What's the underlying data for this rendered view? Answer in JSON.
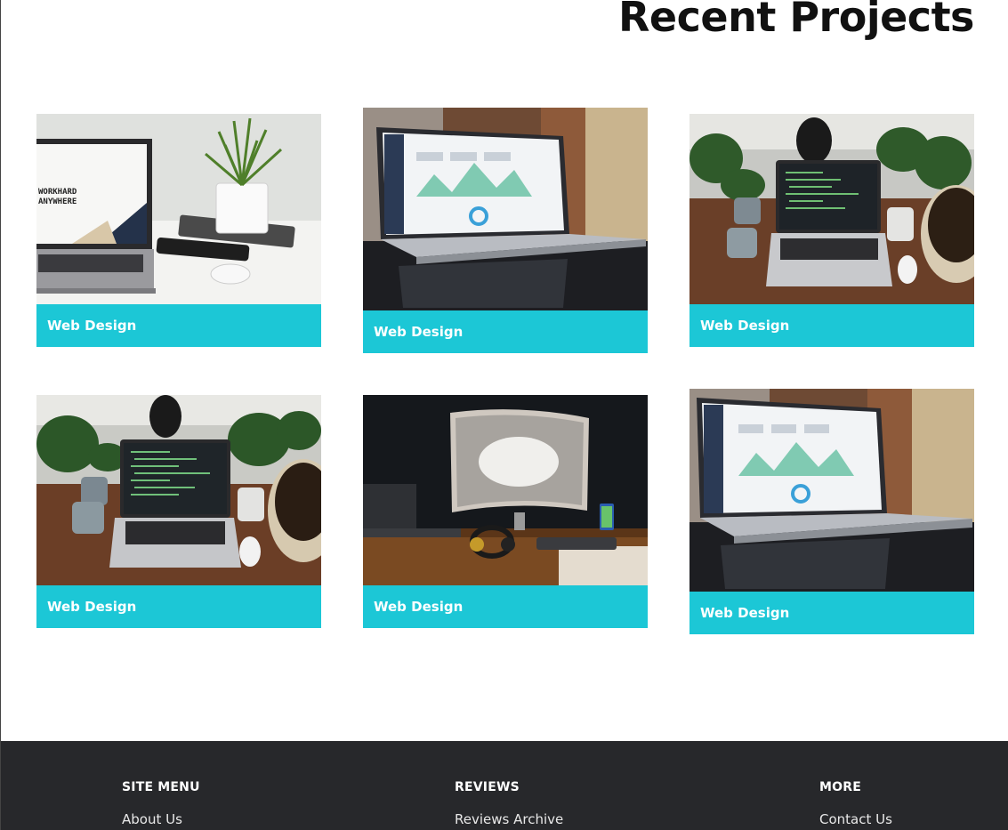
{
  "section": {
    "title": "Recent Projects"
  },
  "projects": [
    {
      "caption": "Web Design"
    },
    {
      "caption": "Web Design"
    },
    {
      "caption": "Web Design"
    },
    {
      "caption": "Web Design"
    },
    {
      "caption": "Web Design"
    },
    {
      "caption": "Web Design"
    }
  ],
  "thumb1": {
    "screen_line1": "WORKHARD",
    "screen_line2": "ANYWHERE"
  },
  "colors": {
    "accent": "#1cc7d6",
    "footer_bg": "#27282b"
  },
  "footer": {
    "columns": [
      {
        "heading": "SITE MENU",
        "link": "About Us"
      },
      {
        "heading": "REVIEWS",
        "link": "Reviews Archive"
      },
      {
        "heading": "MORE",
        "link": "Contact Us"
      }
    ]
  }
}
